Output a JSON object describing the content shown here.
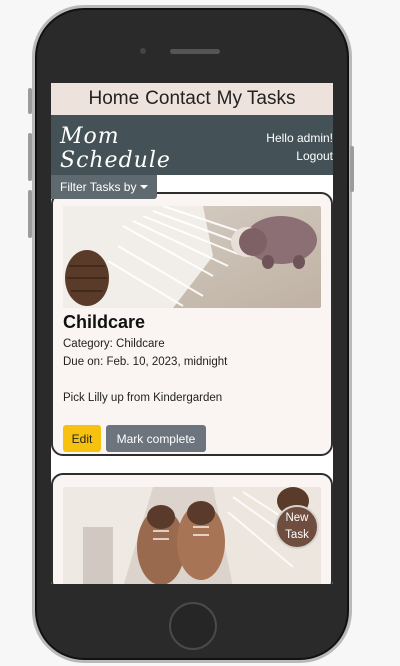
{
  "nav": {
    "home": "Home",
    "contact": "Contact",
    "my_tasks": "My Tasks"
  },
  "header": {
    "brand_line1": "Mom",
    "brand_line2": "Schedule",
    "greeting": "Hello admin!",
    "logout": "Logout"
  },
  "filter": {
    "label": "Filter Tasks by"
  },
  "tasks": [
    {
      "title": "Childcare",
      "category": "Category: Childcare",
      "due": "Due on: Feb. 10, 2023, midnight",
      "description": "Pick Lilly up from Kindergarden",
      "edit_label": "Edit",
      "complete_label": "Mark complete"
    }
  ],
  "new_task": {
    "line1": "New",
    "line2": "Task"
  },
  "colors": {
    "nav_bg": "#eee2dd",
    "header_bg": "#445257",
    "edit_button": "#f7c10f",
    "complete_button": "#6c757d",
    "new_task_button": "#6f4e40"
  }
}
